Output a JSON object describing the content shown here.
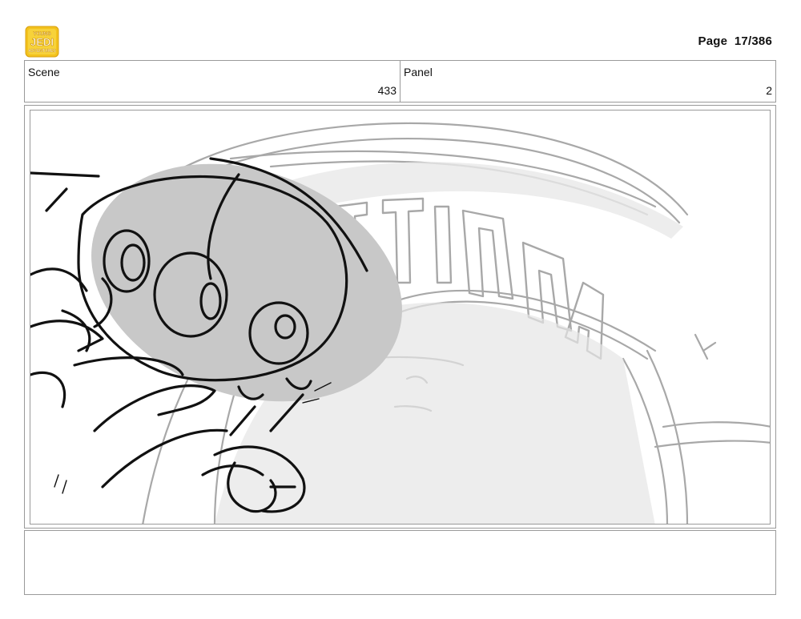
{
  "header": {
    "logo_text": [
      "YOUNG",
      "JEDI",
      "ADVENTURES"
    ],
    "page_prefix": "Page",
    "page_current": "17",
    "page_total": "386"
  },
  "info": {
    "scene_label": "Scene",
    "scene_value": "433",
    "panel_label": "Panel",
    "panel_value": "2"
  },
  "sketch": {
    "icon": "storyboard-sketch-droid-and-sign",
    "ink_color": "#111111",
    "pencil_color": "#a8a8a8",
    "fill_color": "#c8c8c8"
  },
  "notes": {
    "text": ""
  }
}
